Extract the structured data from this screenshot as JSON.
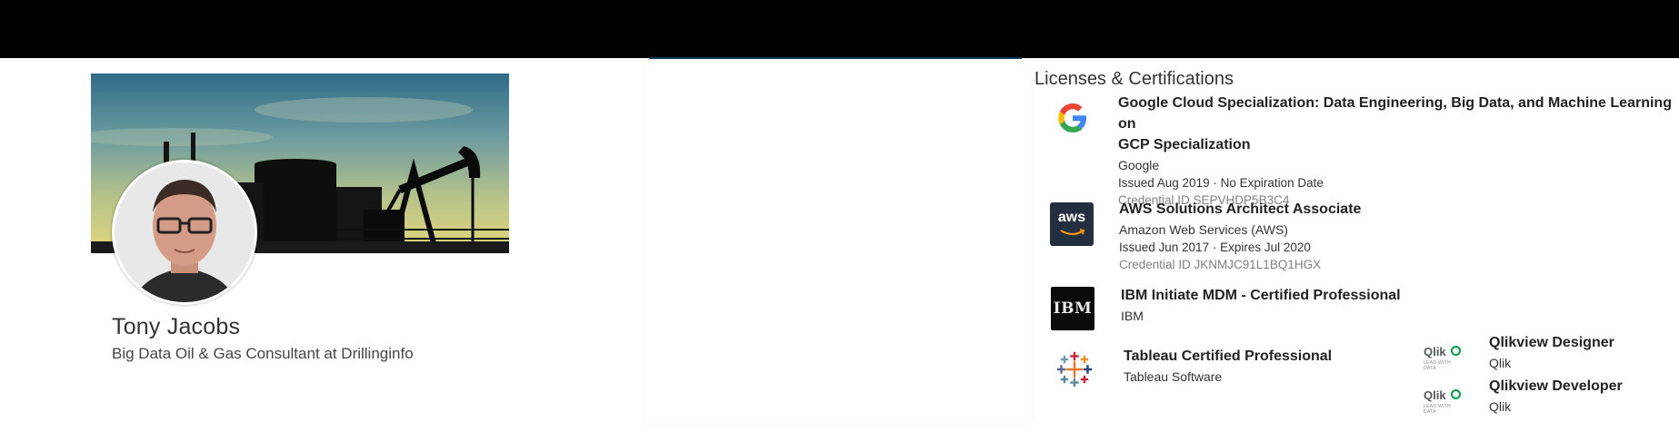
{
  "profile": {
    "name": "Tony Jacobs",
    "headline": "Big Data Oil & Gas Consultant at Drillinginfo"
  },
  "certifications": {
    "title": "Licenses & Certifications",
    "items": [
      {
        "name_line1": "Google Cloud Specialization: Data Engineering, Big Data, and Machine Learning on",
        "name_line2": "GCP Specialization",
        "issuer": "Google",
        "dates": "Issued Aug 2019 · No Expiration Date",
        "credential": "Credential ID SEPVHDP5B3C4",
        "logo_icon": "google-logo-icon"
      },
      {
        "name": "AWS Solutions Architect Associate",
        "issuer": "Amazon Web Services (AWS)",
        "dates": "Issued Jun 2017 · Expires Jul 2020",
        "credential": "Credential ID JKNMJC91L1BQ1HGX",
        "logo_text": "aws",
        "logo_icon": "aws-logo-icon"
      },
      {
        "name": "IBM Initiate MDM - Certified Professional",
        "issuer": "IBM",
        "logo_text": "IBM",
        "logo_icon": "ibm-logo-icon"
      },
      {
        "name": "Tableau Certified Professional",
        "issuer": "Tableau Software",
        "logo_icon": "tableau-logo-icon"
      },
      {
        "name": "Qlikview Designer",
        "issuer": "Qlik",
        "logo_text": "Qlik",
        "logo_tagline": "LEAD WITH DATA",
        "logo_icon": "qlik-logo-icon"
      },
      {
        "name": "Qlikview Developer",
        "issuer": "Qlik",
        "logo_text": "Qlik",
        "logo_tagline": "LEAD WITH DATA",
        "logo_icon": "qlik-logo-icon"
      }
    ]
  },
  "colors": {
    "topbar": "#000000",
    "aws_bg": "#232f3e",
    "aws_smile": "#ff9900",
    "qlik_green": "#009845",
    "credential_text": "#808080"
  }
}
